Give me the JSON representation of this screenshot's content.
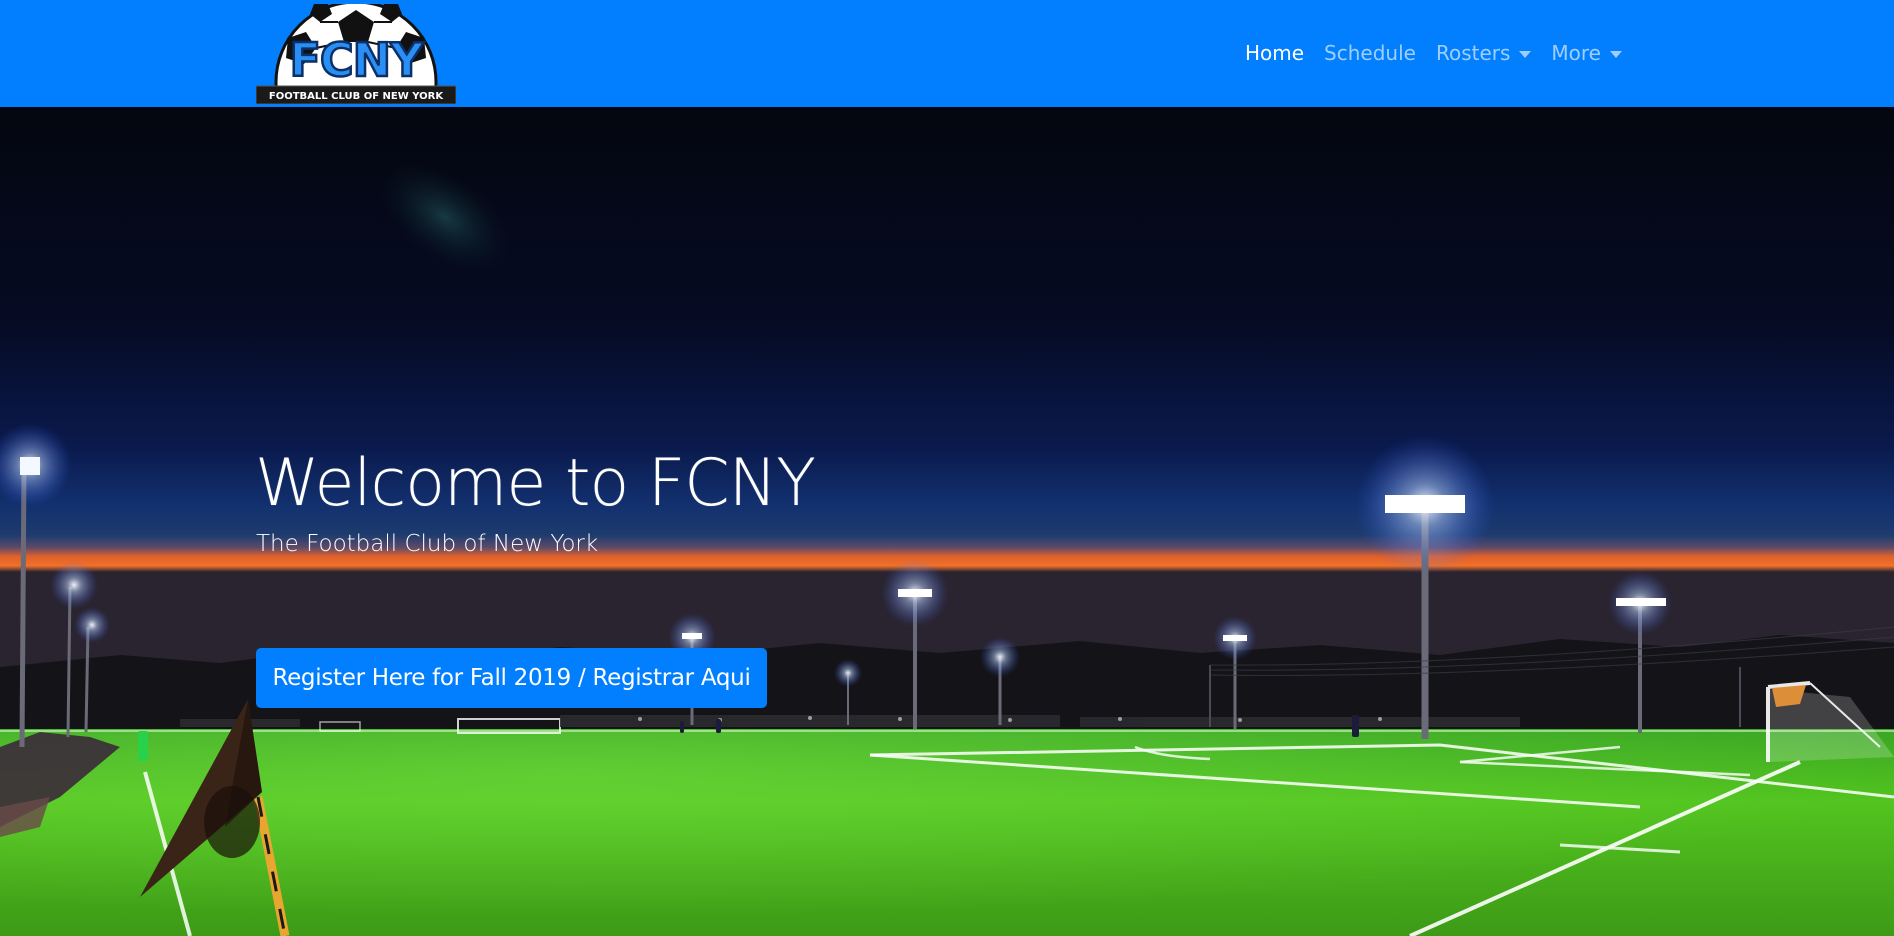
{
  "navbar": {
    "brand": {
      "logo_text": "FCNY",
      "logo_caption": "FOOTBALL CLUB OF NEW YORK"
    },
    "links": [
      {
        "label": "Home",
        "active": true,
        "dropdown": false
      },
      {
        "label": "Schedule",
        "active": false,
        "dropdown": false
      },
      {
        "label": "Rosters",
        "active": false,
        "dropdown": true
      },
      {
        "label": "More",
        "active": false,
        "dropdown": true
      }
    ],
    "background_color": "#017ffe"
  },
  "hero": {
    "title": "Welcome to FCNY",
    "subtitle": "The Football Club of New York",
    "cta_label": "Register Here for Fall 2019 / Registrar Aqui",
    "cta_color": "#017ffe",
    "background_image": "night soccer field with stadium floodlights, sunset horizon and green turf"
  }
}
